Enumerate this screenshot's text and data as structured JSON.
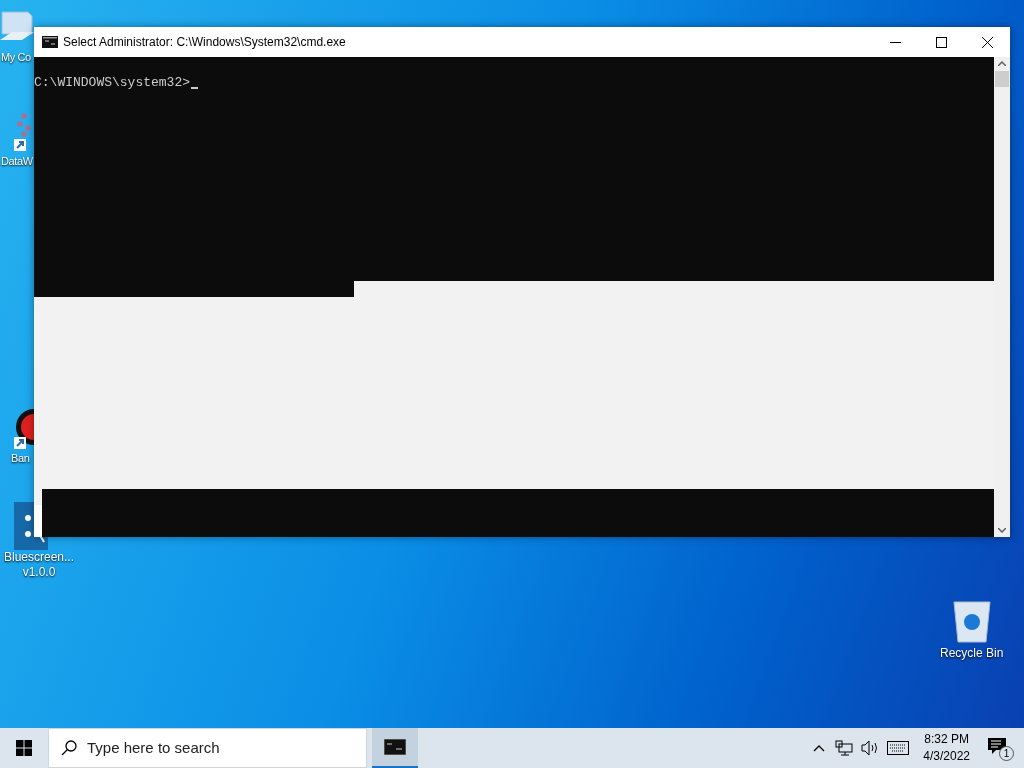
{
  "desktop_icons": [
    {
      "kind": "computer",
      "label": "My Co"
    },
    {
      "kind": "app",
      "label": "DataW"
    },
    {
      "kind": "record",
      "label": "Ban"
    },
    {
      "kind": "tool",
      "label": "Bluescreen... v1.0.0"
    }
  ],
  "recycle_bin": {
    "label": "Recycle Bin"
  },
  "window": {
    "title": "Select Administrator: C:\\Windows\\System32\\cmd.exe",
    "prompt": "C:\\WINDOWS\\system32>"
  },
  "taskbar": {
    "search": {
      "placeholder": "Type here to search"
    },
    "apps": [
      {
        "selected": true
      }
    ],
    "clock": {
      "time": "8:32 PM",
      "date": "4/3/2022"
    },
    "notifications": {
      "count": "1"
    }
  }
}
